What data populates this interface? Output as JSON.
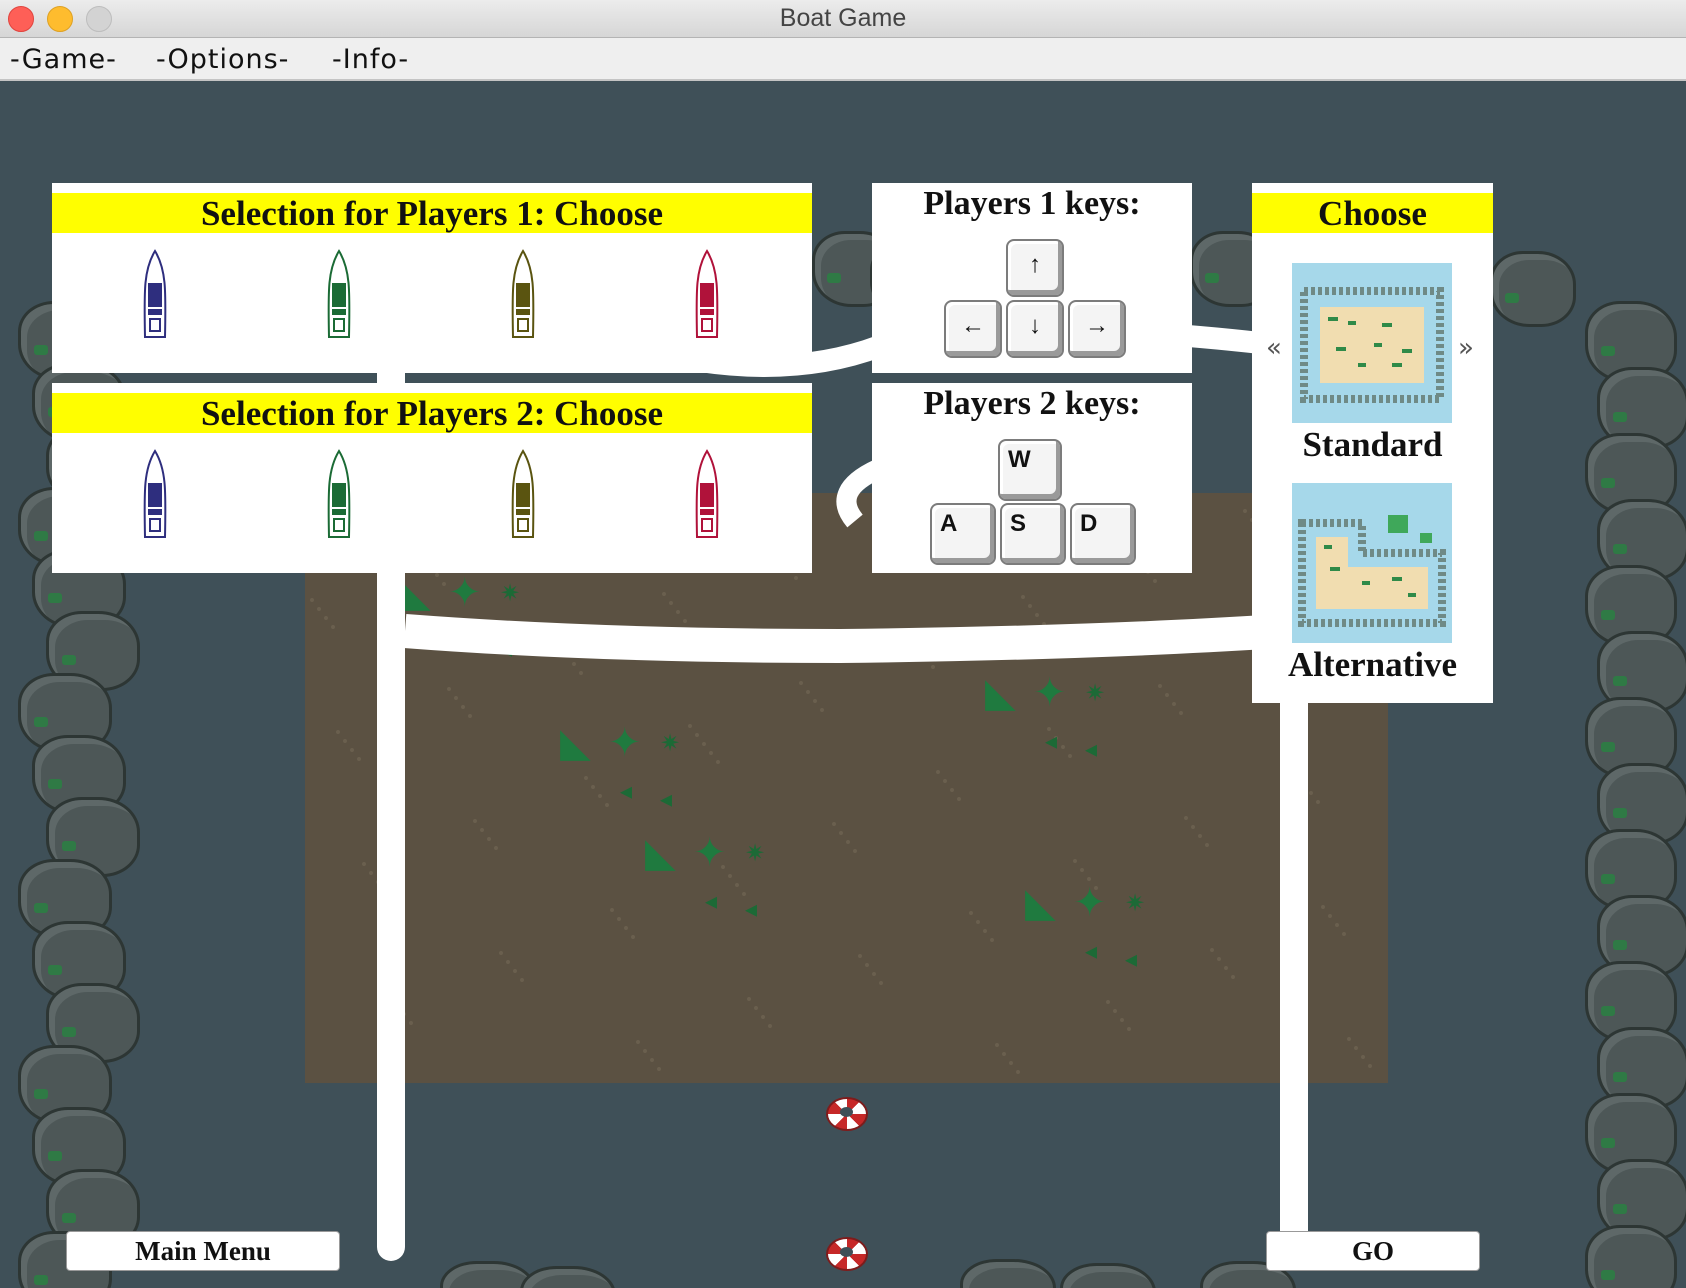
{
  "window": {
    "title": "Boat Game"
  },
  "menu": {
    "items": [
      "-Game-",
      "-Options-",
      "-Info-"
    ]
  },
  "player1": {
    "title": "Selection for Players 1: Choose"
  },
  "player2": {
    "title": "Selection for Players 2: Choose"
  },
  "boats": [
    {
      "color": "#2e2e7e",
      "icon": "blue-boat-icon"
    },
    {
      "color": "#1b6b35",
      "icon": "green-boat-icon"
    },
    {
      "color": "#5a5410",
      "icon": "olive-boat-icon"
    },
    {
      "color": "#b0123a",
      "icon": "red-boat-icon"
    }
  ],
  "keys1": {
    "title": "Players 1 keys:",
    "up": "↑",
    "left": "←",
    "down": "↓",
    "right": "→"
  },
  "keys2": {
    "title": "Players 2 keys:",
    "w": "W",
    "a": "A",
    "s": "S",
    "d": "D"
  },
  "map_choice": {
    "title": "Choose",
    "prev_icon": "«",
    "next_icon": "»",
    "maps": [
      {
        "name": "Standard"
      },
      {
        "name": "Alternative"
      }
    ]
  },
  "buttons": {
    "main_menu": "Main Menu",
    "go": "GO"
  },
  "colors": {
    "highlight": "#fffe00",
    "water": "#3f5058",
    "island": "#5b5142",
    "foliage": "#1f7a3f"
  }
}
